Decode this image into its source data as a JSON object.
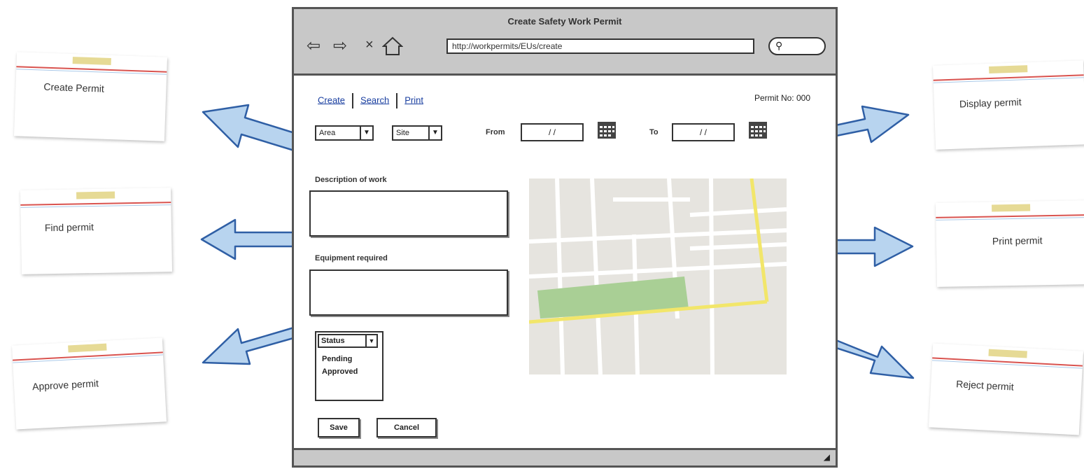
{
  "notes": {
    "create": "Create Permit",
    "find": "Find permit",
    "approve": "Approve permit",
    "display": "Display permit",
    "print": "Print permit",
    "reject": "Reject permit"
  },
  "browser": {
    "title": "Create Safety Work Permit",
    "url": "http://workpermits/EUs/create"
  },
  "nav": {
    "create": "Create",
    "search": "Search",
    "print": "Print"
  },
  "permit_no": "Permit No: 000",
  "filters": {
    "area": "Area",
    "site": "Site",
    "from_label": "From",
    "from_value": "/ /",
    "to_label": "To",
    "to_value": "/ /"
  },
  "form": {
    "description_label": "Description of work",
    "equipment_label": "Equipment required",
    "status": {
      "selected": "Status",
      "options": [
        "Pending",
        "Approved"
      ]
    },
    "save_label": "Save",
    "cancel_label": "Cancel"
  },
  "colors": {
    "arrow_fill": "#b8d4ef",
    "arrow_stroke": "#2f5fa5",
    "map_bg": "#e6e4df",
    "map_park": "#a9cf95",
    "map_road_major": "#f2e66a"
  }
}
